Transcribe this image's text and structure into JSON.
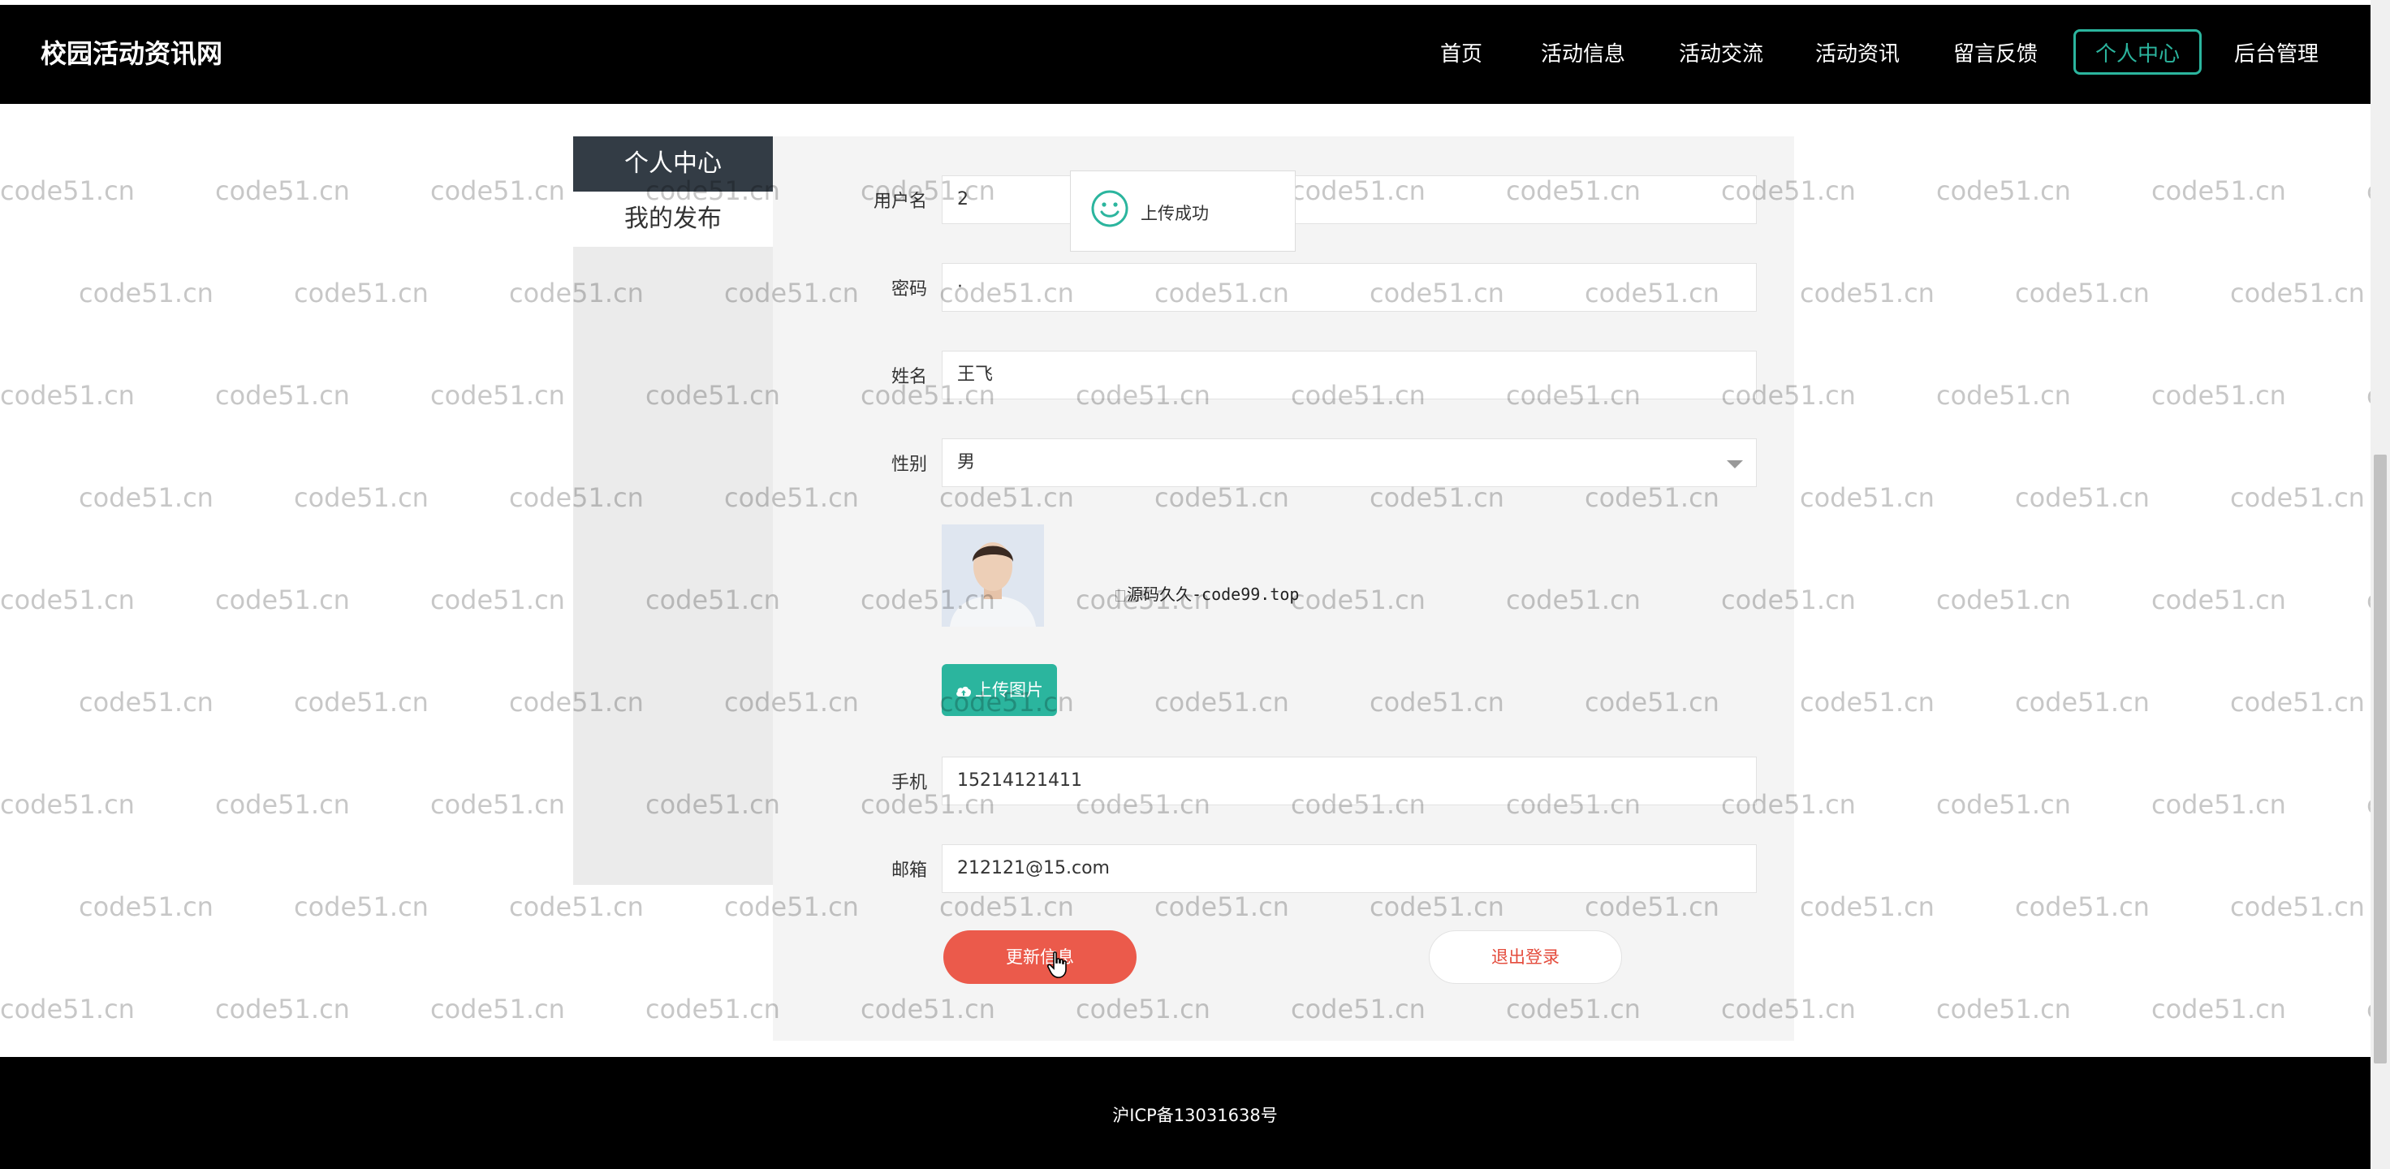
{
  "header": {
    "site_title": "校园活动资讯网",
    "nav": [
      {
        "label": "首页"
      },
      {
        "label": "活动信息"
      },
      {
        "label": "活动交流"
      },
      {
        "label": "活动资讯"
      },
      {
        "label": "留言反馈"
      },
      {
        "label": "个人中心",
        "active": true
      },
      {
        "label": "后台管理"
      }
    ]
  },
  "sidebar": {
    "title": "个人中心",
    "items": [
      {
        "label": "我的发布"
      }
    ]
  },
  "form": {
    "username_label": "用户名",
    "username_value": "2",
    "password_label": "密码",
    "password_value": "·",
    "name_label": "姓名",
    "name_value": "王飞",
    "gender_label": "性别",
    "gender_value": "男",
    "avatar_caption": "源码久久-code99.top",
    "upload_label": "上传图片",
    "phone_label": "手机",
    "phone_value": "15214121411",
    "email_label": "邮箱",
    "email_value": "212121@15.com",
    "update_label": "更新信息",
    "logout_label": "退出登录"
  },
  "toast": {
    "message": "上传成功"
  },
  "footer": {
    "icp": "沪ICP备13031638号"
  },
  "watermark": {
    "text": "code51.cn"
  },
  "colors": {
    "accent": "#2bb59e",
    "danger": "#eb5a4b",
    "header_bg": "#000000",
    "sidebar_title_bg": "#333c45"
  }
}
